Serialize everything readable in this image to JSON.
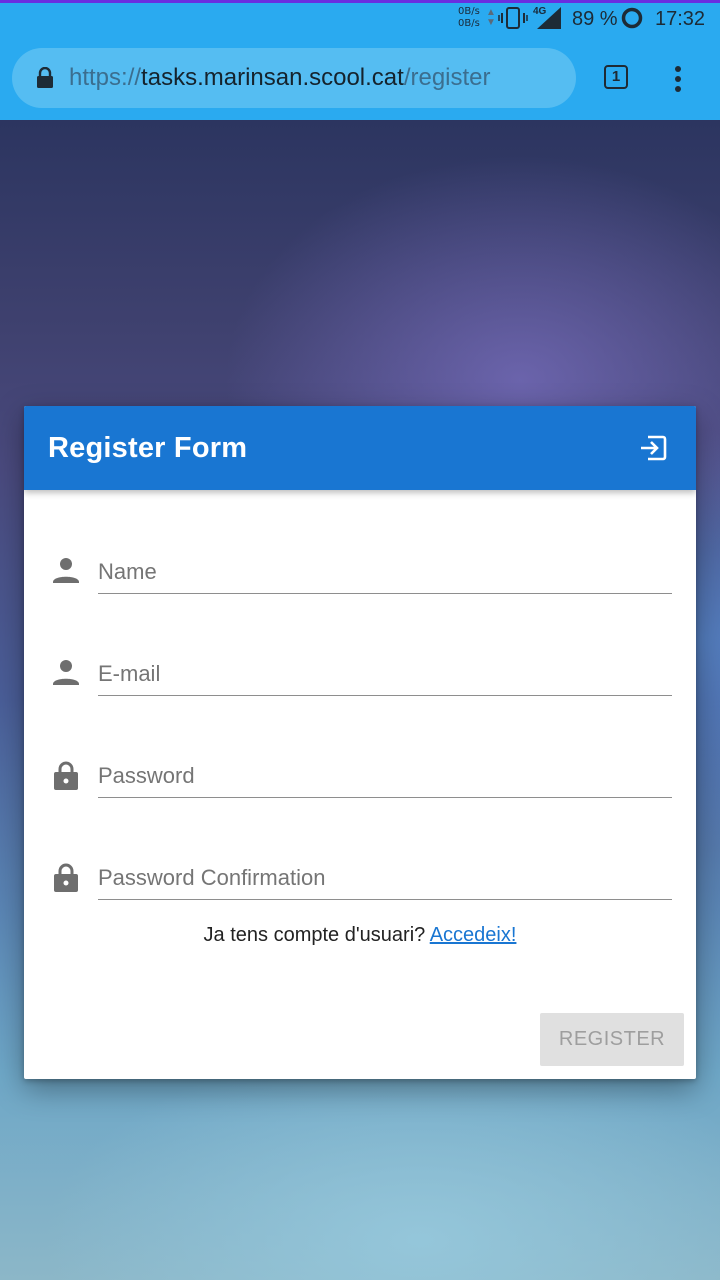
{
  "status_bar": {
    "net_up": "0B/s",
    "net_down": "0B/s",
    "signal_label": "4G",
    "battery": "89 %",
    "time": "17:32"
  },
  "browser": {
    "url_scheme": "https://",
    "url_host": "tasks.marinsan.scool.cat",
    "url_path": "/register",
    "tab_count": "1"
  },
  "form": {
    "title": "Register Form",
    "fields": [
      {
        "placeholder": "Name",
        "icon": "person-icon"
      },
      {
        "placeholder": "E-mail",
        "icon": "person-icon"
      },
      {
        "placeholder": "Password",
        "icon": "lock-icon"
      },
      {
        "placeholder": "Password Confirmation",
        "icon": "lock-icon"
      }
    ],
    "account_prompt": "Ja tens compte d'usuari?",
    "login_link": "Accedeix!",
    "submit_label": "REGISTER"
  },
  "colors": {
    "browser_bar": "#2aaaf0",
    "header": "#1976d2",
    "link": "#1976d2",
    "button_disabled_bg": "#e0e0e0",
    "button_disabled_text": "#9e9e9e"
  }
}
